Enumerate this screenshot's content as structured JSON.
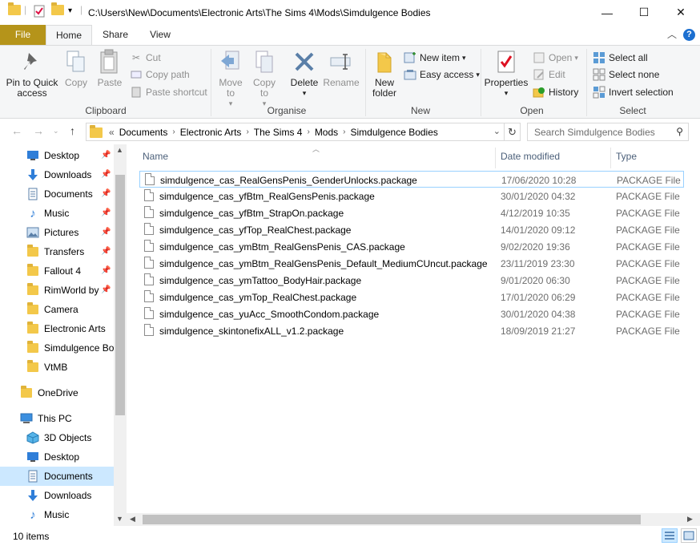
{
  "window": {
    "path_title": "C:\\Users\\New\\Documents\\Electronic Arts\\The Sims 4\\Mods\\Simdulgence Bodies",
    "minimize_glyph": "—",
    "maximize_glyph": "☐",
    "close_glyph": "✕"
  },
  "tabs": {
    "file": "File",
    "home": "Home",
    "share": "Share",
    "view": "View"
  },
  "ribbon": {
    "clipboard": {
      "label": "Clipboard",
      "pin": "Pin to Quick access",
      "copy": "Copy",
      "paste": "Paste",
      "cut": "Cut",
      "copy_path": "Copy path",
      "paste_shortcut": "Paste shortcut"
    },
    "organise": {
      "label": "Organise",
      "move_to": "Move to",
      "copy_to": "Copy to",
      "delete": "Delete",
      "rename": "Rename"
    },
    "new": {
      "label": "New",
      "new_folder": "New folder",
      "new_item": "New item",
      "easy_access": "Easy access"
    },
    "open": {
      "label": "Open",
      "properties": "Properties",
      "open": "Open",
      "edit": "Edit",
      "history": "History"
    },
    "select": {
      "label": "Select",
      "select_all": "Select all",
      "select_none": "Select none",
      "invert": "Invert selection"
    }
  },
  "address": {
    "overflow": "«",
    "segments": [
      "Documents",
      "Electronic Arts",
      "The Sims 4",
      "Mods",
      "Simdulgence Bodies"
    ],
    "search_placeholder": "Search Simdulgence Bodies"
  },
  "sidebar": {
    "quick_access": [
      {
        "label": "Desktop",
        "icon": "desktop-icon"
      },
      {
        "label": "Downloads",
        "icon": "download-icon"
      },
      {
        "label": "Documents",
        "icon": "document-icon"
      },
      {
        "label": "Music",
        "icon": "music-icon"
      },
      {
        "label": "Pictures",
        "icon": "pictures-icon"
      },
      {
        "label": "Transfers",
        "icon": "folder-icon"
      },
      {
        "label": "Fallout 4",
        "icon": "folder-icon"
      },
      {
        "label": "RimWorld by",
        "icon": "folder-icon"
      },
      {
        "label": "Camera",
        "icon": "folder-icon"
      },
      {
        "label": "Electronic Arts",
        "icon": "folder-icon"
      },
      {
        "label": "Simdulgence Bo",
        "icon": "folder-icon"
      },
      {
        "label": "VtMB",
        "icon": "folder-icon"
      }
    ],
    "onedrive": "OneDrive",
    "this_pc": "This PC",
    "this_pc_items": [
      {
        "label": "3D Objects",
        "icon": "3d-objects-icon"
      },
      {
        "label": "Desktop",
        "icon": "desktop-icon"
      },
      {
        "label": "Documents",
        "icon": "document-icon"
      },
      {
        "label": "Downloads",
        "icon": "download-icon"
      },
      {
        "label": "Music",
        "icon": "music-icon"
      }
    ]
  },
  "columns": {
    "name": "Name",
    "date": "Date modified",
    "type": "Type"
  },
  "files": [
    {
      "name": "simdulgence_cas_RealGensPenis_GenderUnlocks.package",
      "date": "17/06/2020 10:28",
      "type": "PACKAGE File"
    },
    {
      "name": "simdulgence_cas_yfBtm_RealGensPenis.package",
      "date": "30/01/2020 04:32",
      "type": "PACKAGE File"
    },
    {
      "name": "simdulgence_cas_yfBtm_StrapOn.package",
      "date": "4/12/2019 10:35",
      "type": "PACKAGE File"
    },
    {
      "name": "simdulgence_cas_yfTop_RealChest.package",
      "date": "14/01/2020 09:12",
      "type": "PACKAGE File"
    },
    {
      "name": "simdulgence_cas_ymBtm_RealGensPenis_CAS.package",
      "date": "9/02/2020 19:36",
      "type": "PACKAGE File"
    },
    {
      "name": "simdulgence_cas_ymBtm_RealGensPenis_Default_MediumCUncut.package",
      "date": "23/11/2019 23:30",
      "type": "PACKAGE File"
    },
    {
      "name": "simdulgence_cas_ymTattoo_BodyHair.package",
      "date": "9/01/2020 06:30",
      "type": "PACKAGE File"
    },
    {
      "name": "simdulgence_cas_ymTop_RealChest.package",
      "date": "17/01/2020 06:29",
      "type": "PACKAGE File"
    },
    {
      "name": "simdulgence_cas_yuAcc_SmoothCondom.package",
      "date": "30/01/2020 04:38",
      "type": "PACKAGE File"
    },
    {
      "name": "simdulgence_skintonefixALL_v1.2.package",
      "date": "18/09/2019 21:27",
      "type": "PACKAGE File"
    }
  ],
  "status": {
    "items": "10 items"
  },
  "colors": {
    "file_tab": "#b5941a",
    "selection": "#cce8ff",
    "folder": "#f3c84a",
    "accent_blue": "#1c6fd0"
  }
}
